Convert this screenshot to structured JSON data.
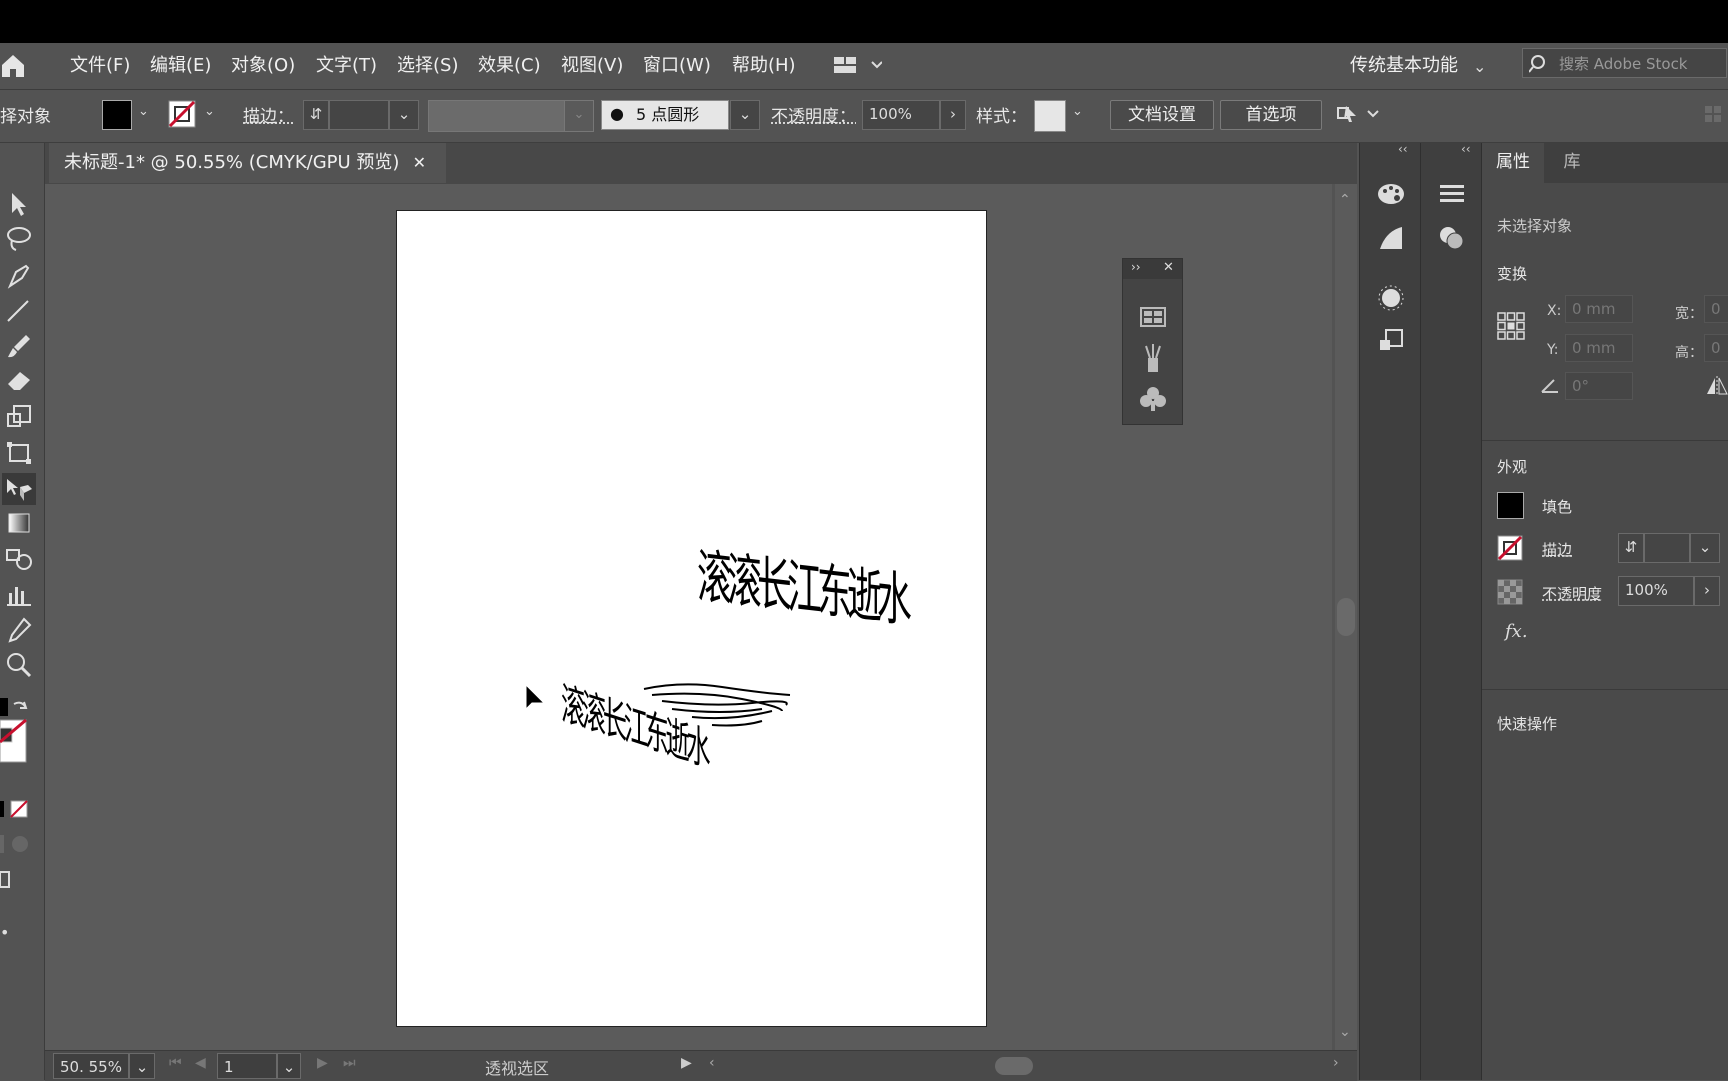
{
  "menubar": {
    "items": [
      "文件(F)",
      "编辑(E)",
      "对象(O)",
      "文字(T)",
      "选择(S)",
      "效果(C)",
      "视图(V)",
      "窗口(W)",
      "帮助(H)"
    ],
    "workspace": "传统基本功能",
    "search_placeholder": "搜索 Adobe Stock"
  },
  "controlbar": {
    "selection_label": "择对象",
    "stroke_label": "描边：",
    "brush_label": "5 点圆形",
    "opacity_label": "不透明度：",
    "opacity_value": "100%",
    "style_label": "样式：",
    "doc_setup": "文档设置",
    "preferences": "首选项"
  },
  "document": {
    "tab_title": "未标题-1* @ 50.55% (CMYK/GPU 预览)",
    "text_upper": "滚滚长江东逝水",
    "text_lower_left": "滚滚长江东逝水"
  },
  "properties": {
    "tab_properties": "属性",
    "tab_library": "库",
    "no_selection": "未选择对象",
    "transform_title": "变换",
    "x_label": "X:",
    "y_label": "Y:",
    "w_label": "宽：",
    "h_label": "高：",
    "x_value": "0 mm",
    "y_value": "0 mm",
    "w_value": "0",
    "h_value": "0",
    "angle_value": "0°",
    "appearance_title": "外观",
    "fill_label": "填色",
    "stroke_label": "描边",
    "opacity_label": "不透明度",
    "opacity_value": "100%",
    "fx_label": "fx.",
    "quick_actions_title": "快速操作"
  },
  "statusbar": {
    "zoom": "50. 55%",
    "page": "1",
    "status_text": "透视选区"
  },
  "colors": {
    "fill": "#000000",
    "stroke_none": "#c8102e",
    "ui_bg": "#535353",
    "artboard": "#ffffff"
  }
}
